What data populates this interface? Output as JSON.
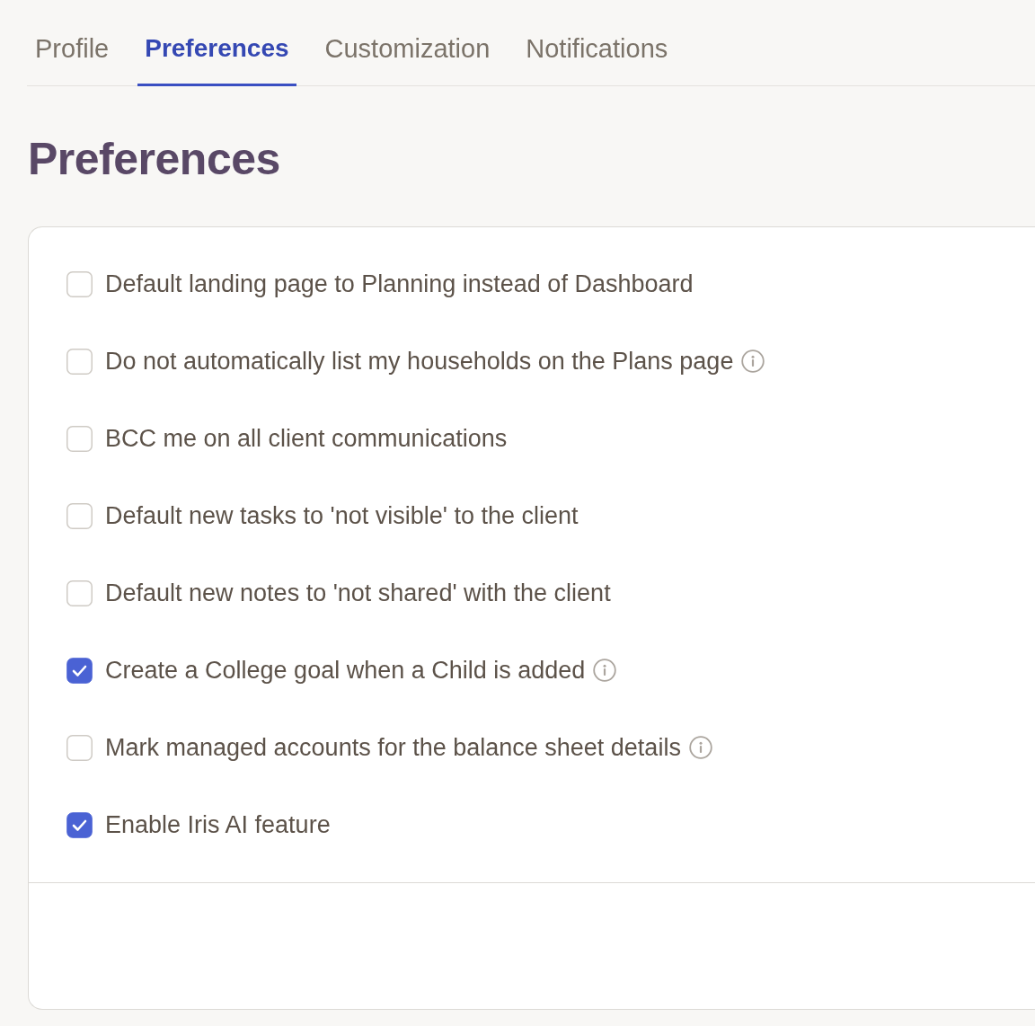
{
  "tabs": [
    {
      "label": "Profile",
      "selected": false
    },
    {
      "label": "Preferences",
      "selected": true
    },
    {
      "label": "Customization",
      "selected": false
    },
    {
      "label": "Notifications",
      "selected": false
    }
  ],
  "heading": "Preferences",
  "options": [
    {
      "label": "Default landing page to Planning instead of Dashboard",
      "checked": false,
      "info": false
    },
    {
      "label": "Do not automatically list my households on the Plans page",
      "checked": false,
      "info": true
    },
    {
      "label": "BCC me on all client communications",
      "checked": false,
      "info": false
    },
    {
      "label": "Default new tasks to 'not visible' to the client",
      "checked": false,
      "info": false
    },
    {
      "label": "Default new notes to 'not shared' with the client",
      "checked": false,
      "info": false
    },
    {
      "label": "Create a College goal when a Child is added",
      "checked": true,
      "info": true
    },
    {
      "label": "Mark managed accounts for the balance sheet details",
      "checked": false,
      "info": true
    },
    {
      "label": "Enable Iris AI feature",
      "checked": true,
      "info": false
    }
  ]
}
